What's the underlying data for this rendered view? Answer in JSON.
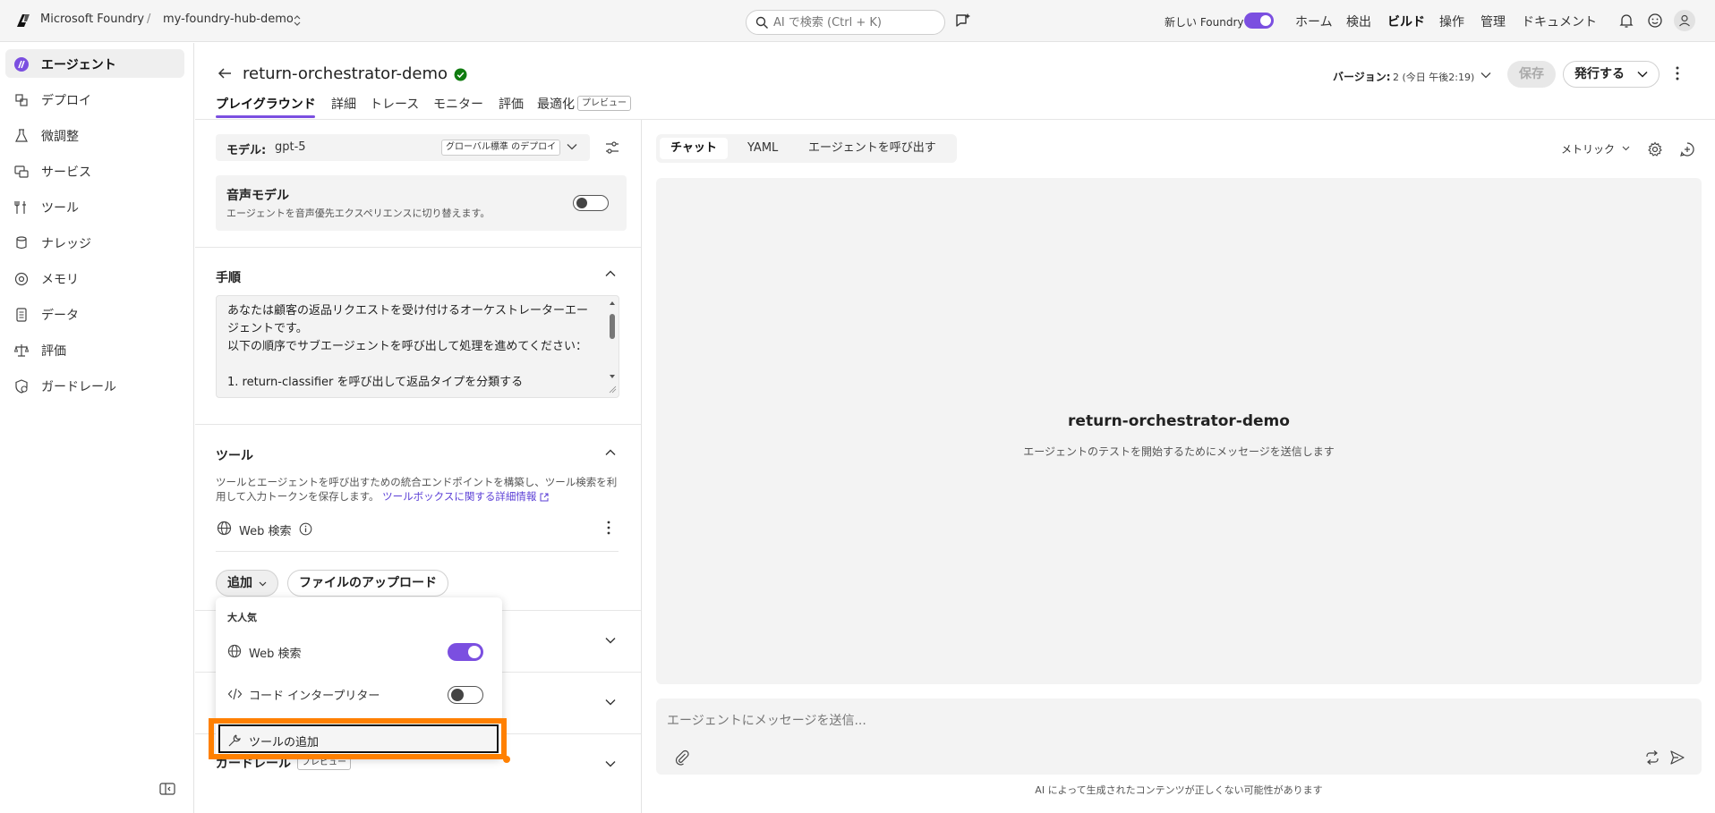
{
  "topbar": {
    "brand": "Microsoft Foundry",
    "separator": "/",
    "project": "my-foundry-hub-demo",
    "search_placeholder": "AI で検索 (Ctrl + K)",
    "new_foundry_label": "新しい Foundry",
    "new_foundry_on": true,
    "nav": [
      "ホーム",
      "検出",
      "ビルド",
      "操作",
      "管理",
      "ドキュメント"
    ],
    "active_nav": "ビルド"
  },
  "sidebar": {
    "items": [
      {
        "label": "エージェント",
        "icon": "agent-icon",
        "active": true
      },
      {
        "label": "デプロイ",
        "icon": "cube-icon"
      },
      {
        "label": "微調整",
        "icon": "flask-icon"
      },
      {
        "label": "サービス",
        "icon": "services-icon"
      },
      {
        "label": "ツール",
        "icon": "tools-icon"
      },
      {
        "label": "ナレッジ",
        "icon": "knowledge-icon"
      },
      {
        "label": "メモリ",
        "icon": "memory-icon"
      },
      {
        "label": "データ",
        "icon": "data-icon"
      },
      {
        "label": "評価",
        "icon": "scale-icon"
      },
      {
        "label": "ガードレール",
        "icon": "shield-icon"
      }
    ]
  },
  "header": {
    "title": "return-orchestrator-demo",
    "tabs": [
      "プレイグラウンド",
      "詳細",
      "トレース",
      "モニター",
      "評価",
      "最適化"
    ],
    "preview_badge": "プレビュー",
    "version_label": "バージョン:",
    "version_value": "2 (今日 午後2:19)",
    "save_label": "保存",
    "publish_label": "発行する"
  },
  "config": {
    "model_label": "モデル:",
    "model_value": "gpt-5",
    "model_tag": "グローバル標準 のデプロイ",
    "voice_title": "音声モデル",
    "voice_desc": "エージェントを音声優先エクスペリエンスに切り替えます。",
    "instructions_title": "手順",
    "instructions_text": "あなたは顧客の返品リクエストを受け付けるオーケストレーターエージェントです。\n以下の順序でサブエージェントを呼び出して処理を進めてください：\n\n1. return-classifier を呼び出して返品タイプを分類する",
    "tools_title": "ツール",
    "tools_desc": "ツールとエージェントを呼び出すための統合エンドポイントを構築し、ツール検索を利用して入力トークンを保存します。",
    "tools_link": "ツールボックスに関する詳細情報",
    "tool_row": "Web 検索",
    "add_label": "追加",
    "upload_label": "ファイルのアップロード",
    "guardrail_label": "ガードレール",
    "guardrail_badge": "プレビュー"
  },
  "dropdown": {
    "header": "大人気",
    "items": [
      {
        "label": "Web 検索",
        "icon": "globe-icon",
        "on": true
      },
      {
        "label": "コード インタープリター",
        "icon": "code-icon",
        "on": false
      }
    ],
    "add_tool": "ツールの追加"
  },
  "chat": {
    "tabs": [
      "チャット",
      "YAML",
      "エージェントを呼び出す"
    ],
    "metrics_label": "メトリック",
    "title": "return-orchestrator-demo",
    "subtitle": "エージェントのテストを開始するためにメッセージを送信します",
    "input_placeholder": "エージェントにメッセージを送信...",
    "disclaimer": "AI によって生成されたコンテンツが正しくない可能性があります"
  },
  "colors": {
    "accent": "#7b4fe0",
    "highlight": "#ff8000",
    "success": "#107c10"
  }
}
